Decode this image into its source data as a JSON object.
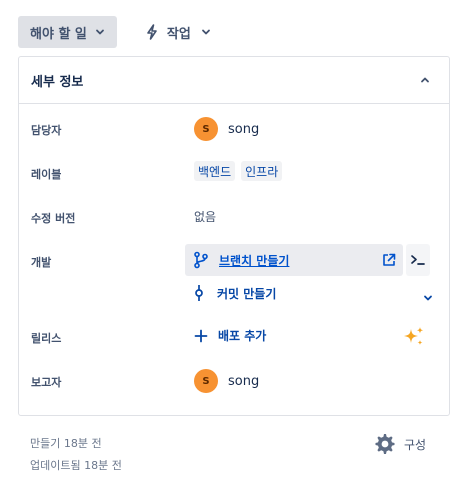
{
  "toolbar": {
    "status_label": "해야 할 일",
    "action_label": "작업"
  },
  "panel": {
    "title": "세부 정보"
  },
  "fields": {
    "assignee": {
      "label": "담당자",
      "avatar_initial": "S",
      "name": "song"
    },
    "labels": {
      "label": "레이블",
      "items": [
        "백엔드",
        "인프라"
      ]
    },
    "fix_version": {
      "label": "수정 버전",
      "value": "없음"
    },
    "development": {
      "label": "개발",
      "branch_link": "브랜치 만들기",
      "commit_link": "커밋 만들기"
    },
    "release": {
      "label": "릴리스",
      "add_label": "배포 추가"
    },
    "reporter": {
      "label": "보고자",
      "avatar_initial": "S",
      "name": "song"
    }
  },
  "footer": {
    "created": "만들기 18분 전",
    "updated": "업데이트됨 18분 전",
    "config_label": "구성"
  },
  "colors": {
    "avatar": "#f79232",
    "link": "#0052cc",
    "label_text": "#0747a6",
    "sparkle": "#f5a623"
  },
  "icons": [
    "chevron-down-icon",
    "lightning-icon",
    "chevron-up-icon",
    "branch-icon",
    "external-link-icon",
    "terminal-icon",
    "commit-icon",
    "plus-icon",
    "sparkle-icon",
    "gear-icon"
  ]
}
